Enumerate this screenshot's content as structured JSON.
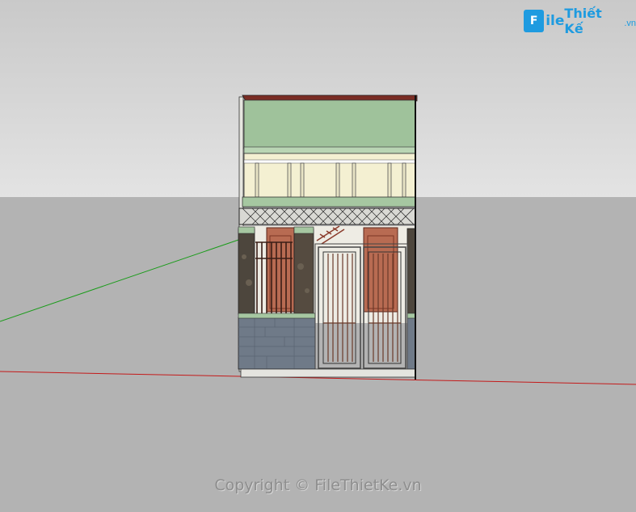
{
  "logo": {
    "letter": "F",
    "file": "ile",
    "brand": "Thiết Kế",
    "tld": ".vn"
  },
  "watermark": "Copyright © FileThietKe.vn",
  "colors": {
    "axis_green": "#00aa00",
    "axis_red": "#cc0000",
    "facade_green": "#9fc29b",
    "roof": "#7a2d24"
  }
}
